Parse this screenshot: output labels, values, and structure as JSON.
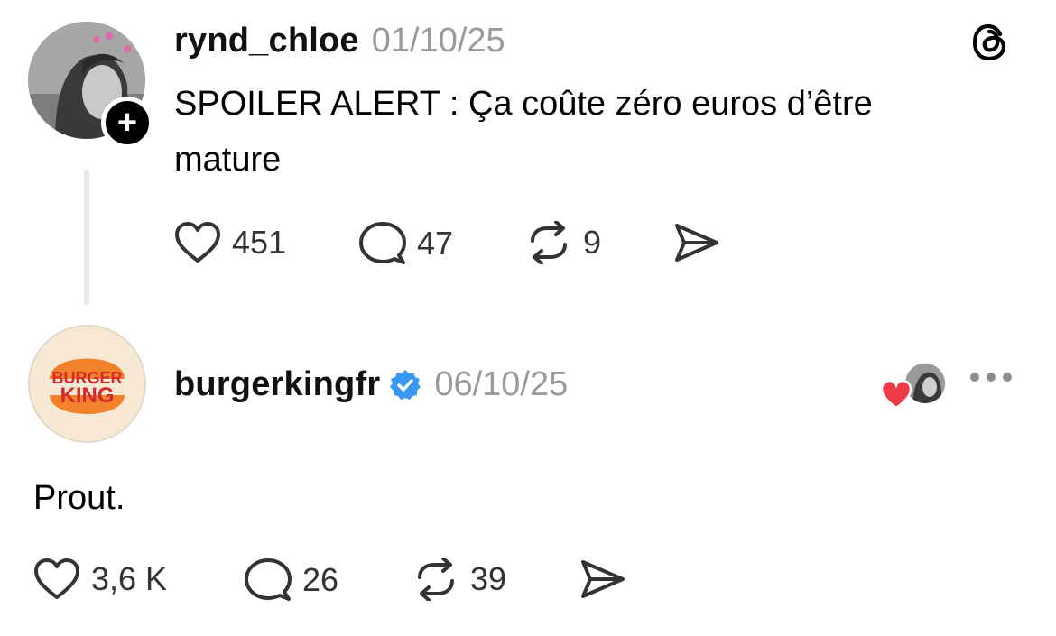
{
  "post1": {
    "username": "rynd_chloe",
    "date": "01/10/25",
    "text_line1": "SPOILER ALERT :  Ça coûte zéro euros d’être",
    "text_line2": "mature",
    "follow_symbol": "+",
    "actions": {
      "likes": "451",
      "replies": "47",
      "reposts": "9"
    }
  },
  "post2": {
    "username": "burgerkingfr",
    "verified": true,
    "date": "06/10/25",
    "text": "Prout.",
    "actions": {
      "likes": "3,6 K",
      "replies": "26",
      "reposts": "39"
    },
    "logo": {
      "line1": "BURGER",
      "line2": "KING"
    }
  },
  "colors": {
    "verified_blue": "#3897f0",
    "heart_red": "#ed3a46",
    "muted_gray": "#9a9a9a",
    "bk_orange": "#f2812c",
    "bk_red": "#d6292c"
  },
  "icons": [
    "threads-logo-icon",
    "heart-icon",
    "comment-icon",
    "repost-icon",
    "share-icon",
    "verified-badge-icon",
    "more-icon"
  ]
}
